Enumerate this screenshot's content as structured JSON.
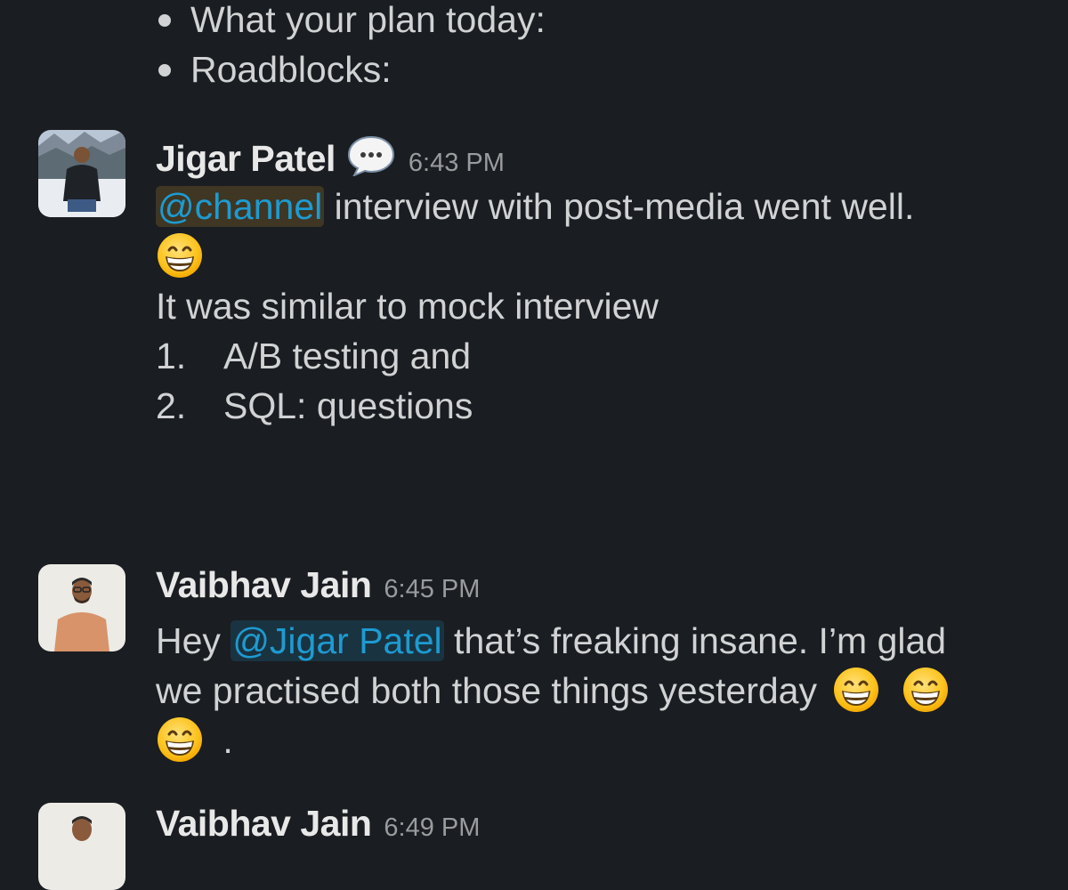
{
  "intro_bullets": [
    "What your plan today:",
    "Roadblocks:"
  ],
  "messages": [
    {
      "sender": "Jigar Patel",
      "status_icon": "speech-bubble-icon",
      "time": "6:43 PM",
      "mention": "@channel",
      "line1_text": " interview with post-media went well.",
      "emoji": "grinning-face-icon",
      "line3": "It was similar to mock interview",
      "list": [
        {
          "num": "1.",
          "text": "A/B testing and"
        },
        {
          "num": "2.",
          "text": "SQL: questions"
        }
      ]
    },
    {
      "sender": "Vaibhav Jain",
      "time": "6:45 PM",
      "prefix": "Hey ",
      "mention": "@Jigar Patel",
      "line1_text": " that’s freaking insane. I’m glad",
      "line2_text": "we practised both those things yesterday",
      "line3_trailing": ".",
      "emoji": "grinning-face-icon"
    },
    {
      "sender": "Vaibhav Jain",
      "time": "6:49 PM"
    }
  ],
  "colors": {
    "background": "#1a1d21",
    "text": "#d1d2d3",
    "mention": "#1d9bd1",
    "timestamp": "#9a9b9d"
  }
}
